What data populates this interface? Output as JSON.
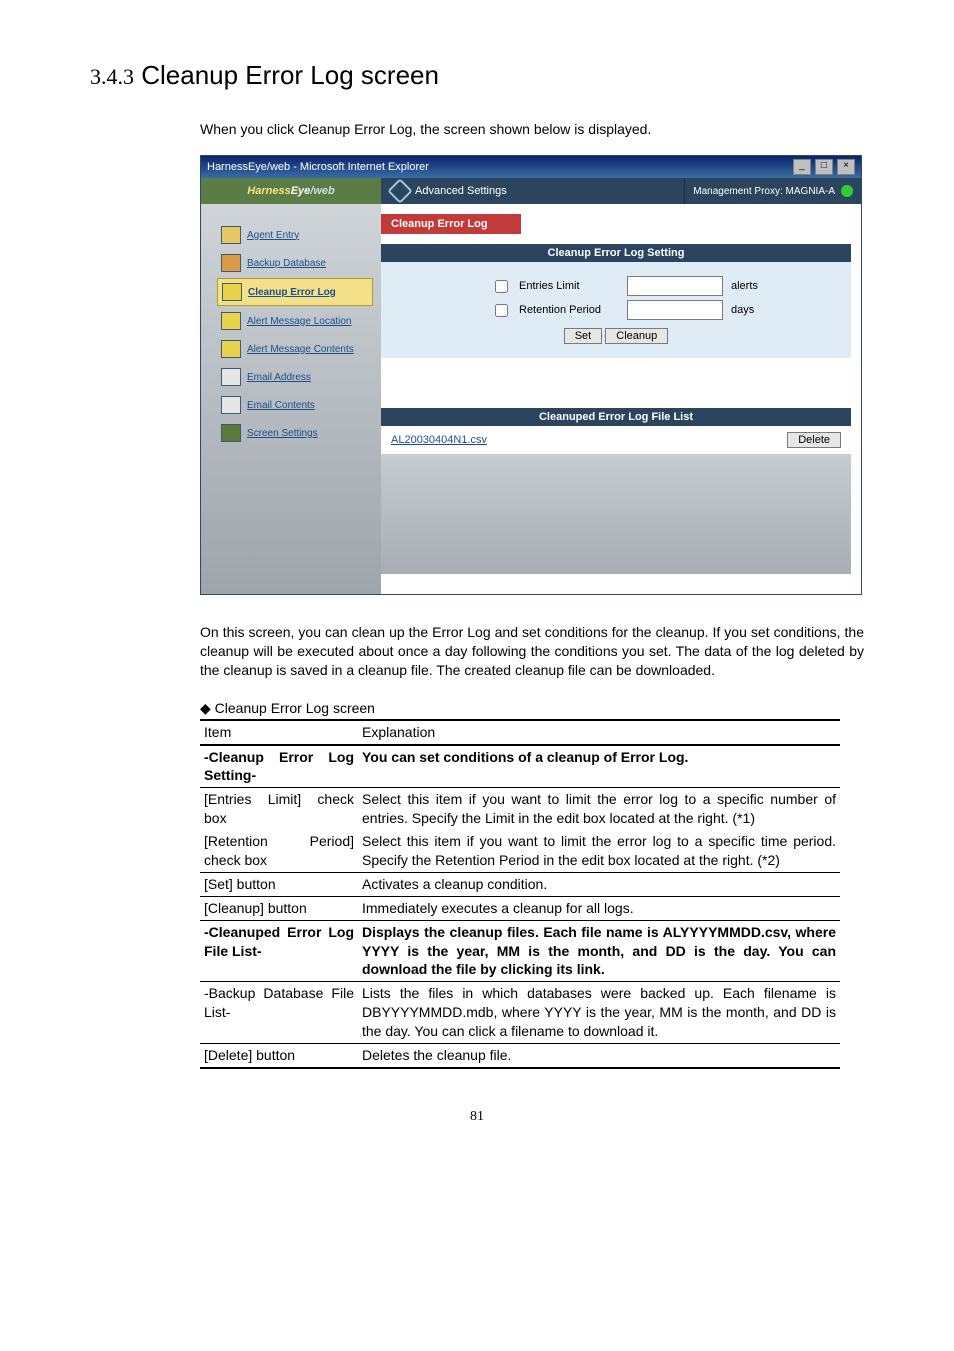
{
  "heading": {
    "number": "3.4.3",
    "title": "Cleanup Error Log screen"
  },
  "intro": "When you click Cleanup Error Log, the screen shown below is displayed.",
  "screenshot": {
    "windowTitle": "HarnessEye/web - Microsoft Internet Explorer",
    "logoPrefix": "Harness",
    "logoMid": "Eye",
    "logoSuffix": "/web",
    "breadcrumb": "Advanced Settings",
    "statusText": "Management Proxy: MAGNIA-A",
    "sidebar": [
      {
        "label": "Agent Entry",
        "active": false
      },
      {
        "label": "Backup Database",
        "active": false
      },
      {
        "label": "Cleanup Error Log",
        "active": true
      },
      {
        "label": "Alert Message Location",
        "active": false
      },
      {
        "label": "Alert Message Contents",
        "active": false
      },
      {
        "label": "Email Address",
        "active": false
      },
      {
        "label": "Email Contents",
        "active": false
      },
      {
        "label": "Screen Settings",
        "active": false
      }
    ],
    "panelTitle": "Cleanup Error Log",
    "settingHeader": "Cleanup Error Log Setting",
    "entriesLimitLabel": "Entries Limit",
    "entriesLimitUnit": "alerts",
    "retentionLabel": "Retention Period",
    "retentionUnit": "days",
    "btnSet": "Set",
    "btnCleanup": "Cleanup",
    "fileListHeader": "Cleanuped Error Log File List",
    "fileName": "AL20030404N1.csv",
    "btnDelete": "Delete"
  },
  "paragraph": "On this screen, you can clean up the Error Log and set conditions for the cleanup. If you set conditions, the cleanup will be executed about once a day following the conditions you set. The data of the log deleted by the cleanup is saved in a cleanup file. The created cleanup file can be downloaded.",
  "tableCaption": "◆ Cleanup Error Log screen",
  "table": {
    "headItem": "Item",
    "headExpl": "Explanation",
    "rows": [
      {
        "item": "-Cleanup Error Log Setting-",
        "expl": "You can set conditions of a cleanup of Error Log.",
        "bold": true,
        "hr": "thick"
      },
      {
        "item": "[Entries Limit] check box",
        "expl": "Select this item if you want to limit the error log to a specific number of entries. Specify the Limit in the edit box located at the right. (*1)",
        "hr": "thin"
      },
      {
        "item": "[Retention Period] check box",
        "expl": "Select this item if you want to limit the error log to a specific time period. Specify the Retention Period in the edit box located at the right. (*2)",
        "hr": "none"
      },
      {
        "item": "[Set] button",
        "expl": "Activates a cleanup condition.",
        "hr": "thin"
      },
      {
        "item": "[Cleanup] button",
        "expl": "Immediately executes a cleanup for all logs.",
        "hr": "thin"
      },
      {
        "item": "-Cleanuped Error Log File List-",
        "expl": "Displays the cleanup files. Each file name is ALYYYYMMDD.csv, where YYYY is the year, MM is the month, and DD is the day. You can download the file by clicking its link.",
        "bold": true,
        "hr": "thin"
      },
      {
        "item": "-Backup Database File List-",
        "expl": "Lists the files in which databases were backed up. Each filename is DBYYYYMMDD.mdb, where YYYY is the year, MM is the month, and DD is the day. You can click a filename to download it.",
        "hr": "thin"
      },
      {
        "item": "[Delete] button",
        "expl": "Deletes the cleanup file.",
        "hr": "thin",
        "hrAfter": "thick"
      }
    ]
  },
  "pageNumber": "81"
}
